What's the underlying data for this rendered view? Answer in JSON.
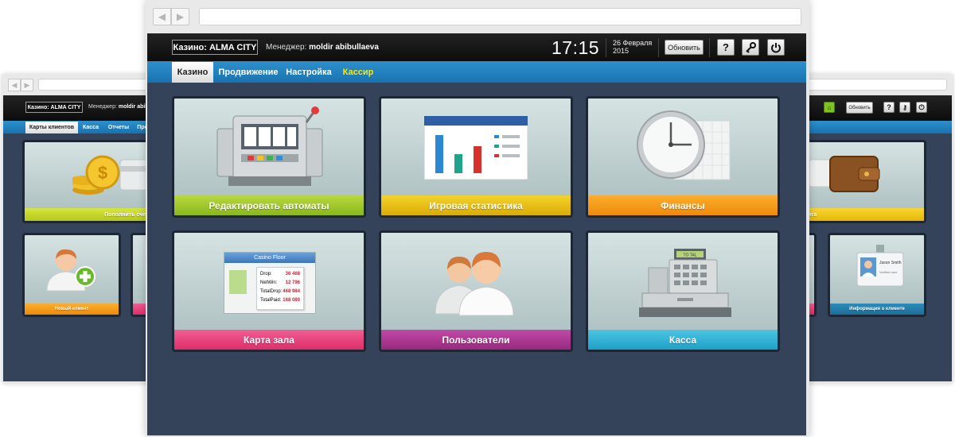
{
  "left_window": {
    "casino_label": "Казино: ALMA CITY",
    "manager_prefix": "Менеджер:",
    "manager_name": "moldir abibullaeva",
    "menu": [
      "Карты клиентов",
      "Касса",
      "Отчеты",
      "Про"
    ],
    "tiles": [
      {
        "label": "Пополнить счет кли",
        "color": "#c6dd2b"
      },
      {
        "label": "Новый клиент",
        "color": "#f5a326"
      }
    ]
  },
  "right_window": {
    "refresh_label": "Обновить",
    "help_icon_text": "?",
    "tiles": [
      {
        "label": "со счета клиента",
        "color": "#f0c81a"
      },
      {
        "label": "Информация о клиенте",
        "color": "#1f7aa6"
      }
    ],
    "badge": {
      "name": "Jason Smith",
      "sub": "Verified user"
    }
  },
  "main_window": {
    "header": {
      "casino_label": "Казино: ALMA CITY",
      "manager_prefix": "Менеджер:",
      "manager_name": "moldir abibullaeva",
      "time": "17:15",
      "date_line1": "26 Февраля",
      "date_line2": "2015",
      "refresh_label": "Обновить",
      "help_icon_text": "?"
    },
    "menu": [
      {
        "label": "Казино",
        "active": true
      },
      {
        "label": "Продвижение",
        "active": false
      },
      {
        "label": "Настройка",
        "active": false
      },
      {
        "label": "Кассир",
        "active": false,
        "highlight": "#ffe800"
      }
    ],
    "tiles": [
      {
        "label": "Редактировать автоматы",
        "icon": "slot-machine-icon",
        "color": "#9cc72a"
      },
      {
        "label": "Игровая статистика",
        "icon": "bar-chart-icon",
        "color": "#e8c316"
      },
      {
        "label": "Финансы",
        "icon": "clock-icon",
        "color": "#f59d1c"
      },
      {
        "label": "Карта зала",
        "icon": "casino-floor-icon",
        "color": "#e8447c"
      },
      {
        "label": "Пользователи",
        "icon": "users-icon",
        "color": "#ad3993"
      },
      {
        "label": "Касса",
        "icon": "cash-register-icon",
        "color": "#35b2d8"
      }
    ],
    "casino_floor": {
      "title": "Casino Floor",
      "rows": [
        {
          "key": "Drop:",
          "value": "36 468"
        },
        {
          "key": "NetWin:",
          "value": "12 796"
        },
        {
          "key": "TotalDrop:",
          "value": "468 984"
        },
        {
          "key": "TotalPaid:",
          "value": "168 080"
        }
      ]
    },
    "register_display": "TO TAL"
  }
}
